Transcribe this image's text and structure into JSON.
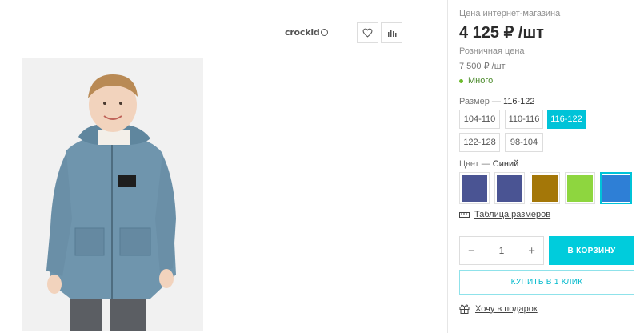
{
  "gallery": {
    "brand": "crockid",
    "favorite_icon": "heart-icon",
    "compare_icon": "bar-chart-icon"
  },
  "price": {
    "label": "Цена интернет-магазина",
    "value": "4 125 ₽ /шт",
    "retail_label": "Розничная цена",
    "retail_value": "7 500 ₽ /шт"
  },
  "stock": {
    "label": "Много",
    "color": "#6cbb2c"
  },
  "size": {
    "label": "Размер",
    "dash": "—",
    "selected": "116-122",
    "options": [
      "104-110",
      "110-116",
      "116-122",
      "122-128",
      "98-104"
    ]
  },
  "color": {
    "label": "Цвет",
    "dash": "—",
    "selected": "Синий",
    "swatches": [
      "#4a5493",
      "#4a5493",
      "#a47708",
      "#8ed63f",
      "#2e7fd6"
    ],
    "selected_index": 4
  },
  "size_table": {
    "label": "Таблица размеров",
    "icon": "ruler-icon"
  },
  "quantity": {
    "minus": "−",
    "value": "1",
    "plus": "+"
  },
  "cart_button": {
    "label": "В КОРЗИНУ"
  },
  "one_click_button": {
    "label": "КУПИТЬ В 1 КЛИК"
  },
  "gift": {
    "label": "Хочу в подарок",
    "icon": "gift-icon"
  },
  "accent_color": "#00c3d8"
}
